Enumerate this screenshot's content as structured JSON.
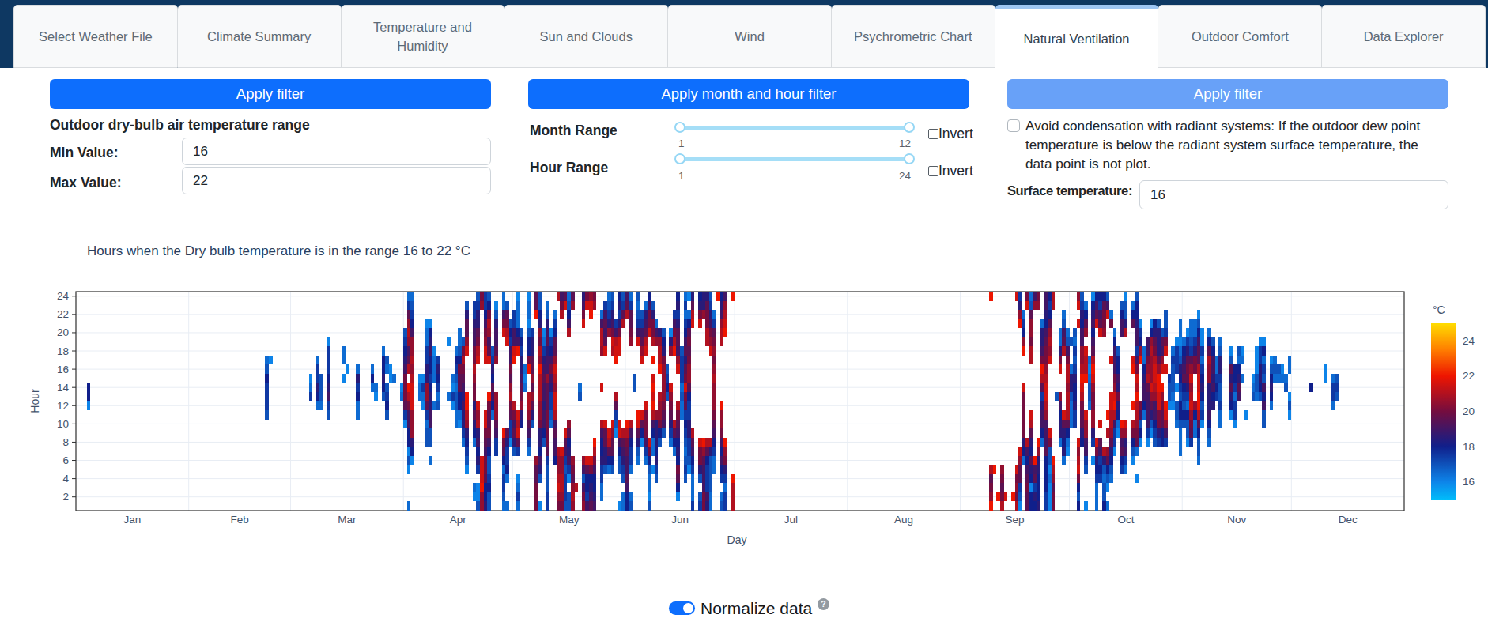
{
  "tabs": [
    {
      "label": "Select Weather File",
      "active": false
    },
    {
      "label": "Climate Summary",
      "active": false
    },
    {
      "label": "Temperature and Humidity",
      "active": false
    },
    {
      "label": "Sun and Clouds",
      "active": false
    },
    {
      "label": "Wind",
      "active": false
    },
    {
      "label": "Psychrometric Chart",
      "active": false
    },
    {
      "label": "Natural Ventilation",
      "active": true
    },
    {
      "label": "Outdoor Comfort",
      "active": false
    },
    {
      "label": "Data Explorer",
      "active": false
    }
  ],
  "filters": {
    "dbt": {
      "apply_label": "Apply filter",
      "heading": "Outdoor dry-bulb air temperature range",
      "min_label": "Min Value:",
      "min_value": "16",
      "max_label": "Max Value:",
      "max_value": "22"
    },
    "month_hour": {
      "apply_label": "Apply month and hour filter",
      "month_label": "Month Range",
      "month_min": "1",
      "month_max": "12",
      "hour_label": "Hour Range",
      "hour_min": "1",
      "hour_max": "24",
      "invert_label": "Invert"
    },
    "condensation": {
      "apply_label": "Apply filter",
      "checkbox_label": "Avoid condensation with radiant systems: If the outdoor dew point temperature is below the radiant system surface temperature, the data point is not plot.",
      "surface_label": "Surface temperature:",
      "surface_value": "16"
    }
  },
  "colors": {
    "navbar": "#0e3862",
    "accent": "#0d6efd",
    "accent_light": "#68a1f8",
    "active_tab_bar": "#9ec6f3",
    "slider": "#a5def7",
    "chart_text": "#2a3f5f"
  },
  "chart_data": {
    "type": "heatmap",
    "title": "Hours when the Dry bulb temperature is in the range 16 to 22 °C",
    "xlabel": "Day",
    "ylabel": "Hour",
    "x_ticklabels": [
      "Jan",
      "Feb",
      "Mar",
      "Apr",
      "May",
      "Jun",
      "Jul",
      "Aug",
      "Sep",
      "Oct",
      "Nov",
      "Dec"
    ],
    "month_start_days": [
      1,
      32,
      60,
      91,
      121,
      152,
      182,
      213,
      244,
      274,
      305,
      335
    ],
    "y_ticks": [
      2,
      4,
      6,
      8,
      10,
      12,
      14,
      16,
      18,
      20,
      22,
      24
    ],
    "x_range_days": [
      1,
      365
    ],
    "y_range_hours": [
      1,
      24
    ],
    "filter_range_c": [
      16,
      22
    ],
    "colorbar": {
      "title": "°C",
      "ticks": [
        16,
        18,
        20,
        22,
        24
      ],
      "min": 14.95,
      "max": 25.0,
      "stops": [
        {
          "t": 14.95,
          "color": "#00befb"
        },
        {
          "t": 16.0,
          "color": "#0d84e9"
        },
        {
          "t": 18.0,
          "color": "#101f8b"
        },
        {
          "t": 20.0,
          "color": "#740d3f"
        },
        {
          "t": 22.0,
          "color": "#ee1500"
        },
        {
          "t": 23.5,
          "color": "#ff7e00"
        },
        {
          "t": 25.0,
          "color": "#ffdd00"
        }
      ]
    },
    "value_encoding": {
      "empty": ".",
      "t0": 15.0,
      "step": 0.5,
      "note": "each string = one day, 24 chars = hours 1..24 bottom-up; hex digit d -> temperature t0+step*d in deg C; '.' = hour filtered out"
    },
    "days": [
      "........................",
      "........................",
      "........................",
      "...........266..........",
      "........................",
      "........................",
      "........................",
      "........................",
      "........................",
      "........................",
      "........................",
      "........................",
      "........................",
      "........................",
      "........................",
      "........................",
      "........................",
      "........................",
      "........................",
      "........................",
      "........................",
      "........................",
      "........................",
      "........................",
      "........................",
      "........................",
      "........................",
      "........................",
      "........................",
      "........................",
      "........................",
      "........................",
      "........................",
      "........................",
      "........................",
      "........................",
      "........................",
      "........................",
      "........................",
      "........................",
      "........................",
      "........................",
      "........................",
      "........................",
      "........................",
      "........................",
      "........................",
      "........................",
      "........................",
      "........................",
      "........................",
      "........................",
      "..........4555643.......",
      "................2.......",
      "........................",
      "........................",
      "........................",
      "........................",
      "........................",
      "........................",
      "........................",
      "........................",
      "........................",
      "........................",
      "............532.........",
      "........................",
      "...........367553.......",
      "...........3444.........",
      "........................",
      "..........458765552.....",
      "........................",
      "........................",
      "........................",
      "..............2.33......",
      "...............2........",
      "........................",
      "........................",
      "..........336573........",
      "........................",
      "........................",
      "........................",
      ".............363........",
      "............23..........",
      "........................",
      "............467663......",
      "..........4654.34.......",
      "..............22........",
      "..............3.........",
      "........................",
      "............32..........",
      ".........259aaa87654....",
      "3...2426688ace.c98bcb953",
      ".....267bbbdddcbcbb86543",
      "........................",
      "............332.........",
      "...........2352.........",
      ".......44359bb7755332...",
      ".....3.44887765668762...",
      "...........3..3332......",
      "...........435675.......",
      "........................",
      "........................",
      "............3.....2.....",
      "...........2523.........",
      ".........334434563......",
      ".........236699a6433....",
      ".......35778789aca4.....",
      "....24567bcee....db9974.",
      "........................",
      ".23....36797aabcaa88755.",
      "422.57687cbd....dca97754",
      "bbeddd................ba",
      "7669aa89add.....ddba8655",
      "44654468a99ae...d98bca64",
      "..........36896754......",
      "......5589bbb...b988742.",
      "........................",
      "3455369ae..........da833",
      "3..365579.........dca94.",
      ".......2559acb9a88564...",
      "......4798ac....ed8855..",
      "3532..59dcd......e863332",
      ".........67ba9877564....",
      ".............323........",
      "......3589bcc..ea6642332",
      ".........479b9b99775....",
      "aaa99b...............e99",
      "2..478677abbcccebcab7644",
      ".......4688788987532....",
      "5544459aaaa999b88798743.",
      ".........345578a8652....",
      ".....68898cddbcdb99653..",
      "abdcbbc................c",
      "abccbbd..............ca8",
      "45554589d.............d9",
      "44.258769b.........c8643",
      "bcb9ab................b9",
      "..c.....................",
      "............43..........",
      "ba848b..............da87",
      "85669d................da",
      "9876ad...............edb",
      "87668ace..............ba",
      "........................",
      ".33557668c...d...bcc83..",
      "....47799d.......d98985.",
      "....369cd..........b7543",
      "....4699bd.......cda8754",
      "........2459c...edc85...",
      "2...4468dd.......dda7576",
      "33.45789c...........c954",
      "6689889ace...........c98",
      "43..35568c........ba9953",
      ".............44.........",
      ".....3479de.......d85434",
      ".......269d.....db9854..",
      ".....358aaad.....dc9873.",
      "423346ad...........daa86",
      "....2.3368ceded.e.caa74.",
      "...4576777b.......b83...",
      ".......46abbc..eccb7....",
      "........489abbbba764....",
      "............4654........",
      ".......3579abd...b72....",
      "......369c.......eca85..",
      ".269a67689ac...db8997576",
      "..........33435554......",
      "...454345659ada979865353",
      "....2455775569bba9a963.2",
      "53335689c...........dc97",
      "........................",
      "54.47aad............da76",
      "aa8889be.............b77",
      "7855569c..........ccaa97",
      "3344447c.........dba8754",
      "....335689abbbcbaba953..",
      ".......................e",
      "43.56868abbe......ccb876",
      "55357abe...........edcb8",
      "........................",
      "ccce...................e",
      "........................",
      "........................",
      "........................",
      "........................",
      "........................",
      "........................",
      "........................",
      "........................",
      "........................",
      "........................",
      "........................",
      "........................",
      "........................",
      "........................",
      "........................",
      "........................",
      "........................",
      "........................",
      "........................",
      "........................",
      "........................",
      "........................",
      "........................",
      "........................",
      "........................",
      "........................",
      "........................",
      "........................",
      "........................",
      "........................",
      "........................",
      "........................",
      "........................",
      "........................",
      "........................",
      "........................",
      "........................",
      "........................",
      "........................",
      "........................",
      "........................",
      "........................",
      "........................",
      "........................",
      "........................",
      "........................",
      "........................",
      "........................",
      "........................",
      "........................",
      "........................",
      "........................",
      "........................",
      "........................",
      "........................",
      "........................",
      "........................",
      "........................",
      "........................",
      "........................",
      "........................",
      "........................",
      "........................",
      "........................",
      "........................",
      "........................",
      "........................",
      "........................",
      "........................",
      "........................",
      "eba9c..................e",
      "....e...................",
      ".e......................",
      "ca9ab...................",
      ".d......................",
      "........................",
      ".e......................",
      "cabad..................d",
      "24599bd.............eb75",
      ".....367aaaaad...eb653..",
      "99a9868c..............da",
      "662679679cd.....ccabb943",
      "67598e................b8",
      "766677be..............ba",
      ".......3688759cea8773...",
      "5566669888bcddcbaa986788",
      "2223244ad.......dbcb9656",
      "aa9bce................cc",
      "............4...........",
      ".......37768b..da733....",
      ".....37679d......c9843..",
      "......2369cccbcca843....",
      ".........3334773..4.....",
      ".........55766754534....",
      "646adcbd............d.db",
      ".......6799acdecbb886754",
      "2...4588bbd...eccd.b963.",
      "...........344323.......",
      ".....2.57bbaabdec9868762",
      "333567ad............d986",
      "...56589.d.........d9856",
      "644347c............baa96",
      "3.2469b.c.e..........d84",
      "...34679bccdd...d...a3..",
      "......2558cedba88863....",
      "........2367a78664......",
      "....5698be.........8864.",
      "....3587bd.........c7442",
      "........................",
      ".....246ac.e...ed...963.",
      "...2..39abccecda85887664",
      ".......2648a....eb652...",
      "..........36887633......",
      ".......2588889cba88.....",
      "........2479bdbbbcb62...",
      ".......45688bcddca976...",
      ".......57aaddeeb97774...",
      ".......6699abe.db894....",
      ".......58bde...d.da544..",
      "...........2445.........",
      "...........2344453......",
      ".........344.2.5552.....",
      "......333466456743233...",
      ".........4645698763.....",
      ".......24463579a9752....",
      ".......59abdcbdb95433...",
      "........336b...aa7533...",
      ".....34469ceeddc998642..",
      ".........25467653522....",
      "........................",
      ".......3468777bbc963....",
      "...........76878864.....",
      "............56533.......",
      ".........3354457743.....",
      "........................",
      "........................",
      "..........26797942......",
      ".........2553566........",
      "............897634......",
      "..............3.32......",
      "..........2.............",
      "........................",
      "............432.........",
      "............344222......",
      "............4677552.....",
      ".........4486845362.....",
      "........................",
      "...........367642.......",
      "..............343.......",
      "..............34........",
      "..............32........",
      ".............43.........",
      "..........242..33.......",
      "........................",
      "........................",
      "........................",
      "........................",
      "........................",
      ".............6..........",
      "........................",
      "........................",
      "........................",
      "..............22........",
      "........................",
      "...........3553.........",
      "............454.........",
      "........................",
      "........................",
      "........................",
      "........................",
      "........................",
      "........................",
      "........................",
      "........................",
      "........................",
      "........................",
      "........................",
      "........................",
      "........................",
      "........................",
      "........................",
      "........................",
      "........................",
      "........................"
    ]
  },
  "footer": {
    "normalize_label": "Normalize data",
    "help_icon": "?"
  }
}
